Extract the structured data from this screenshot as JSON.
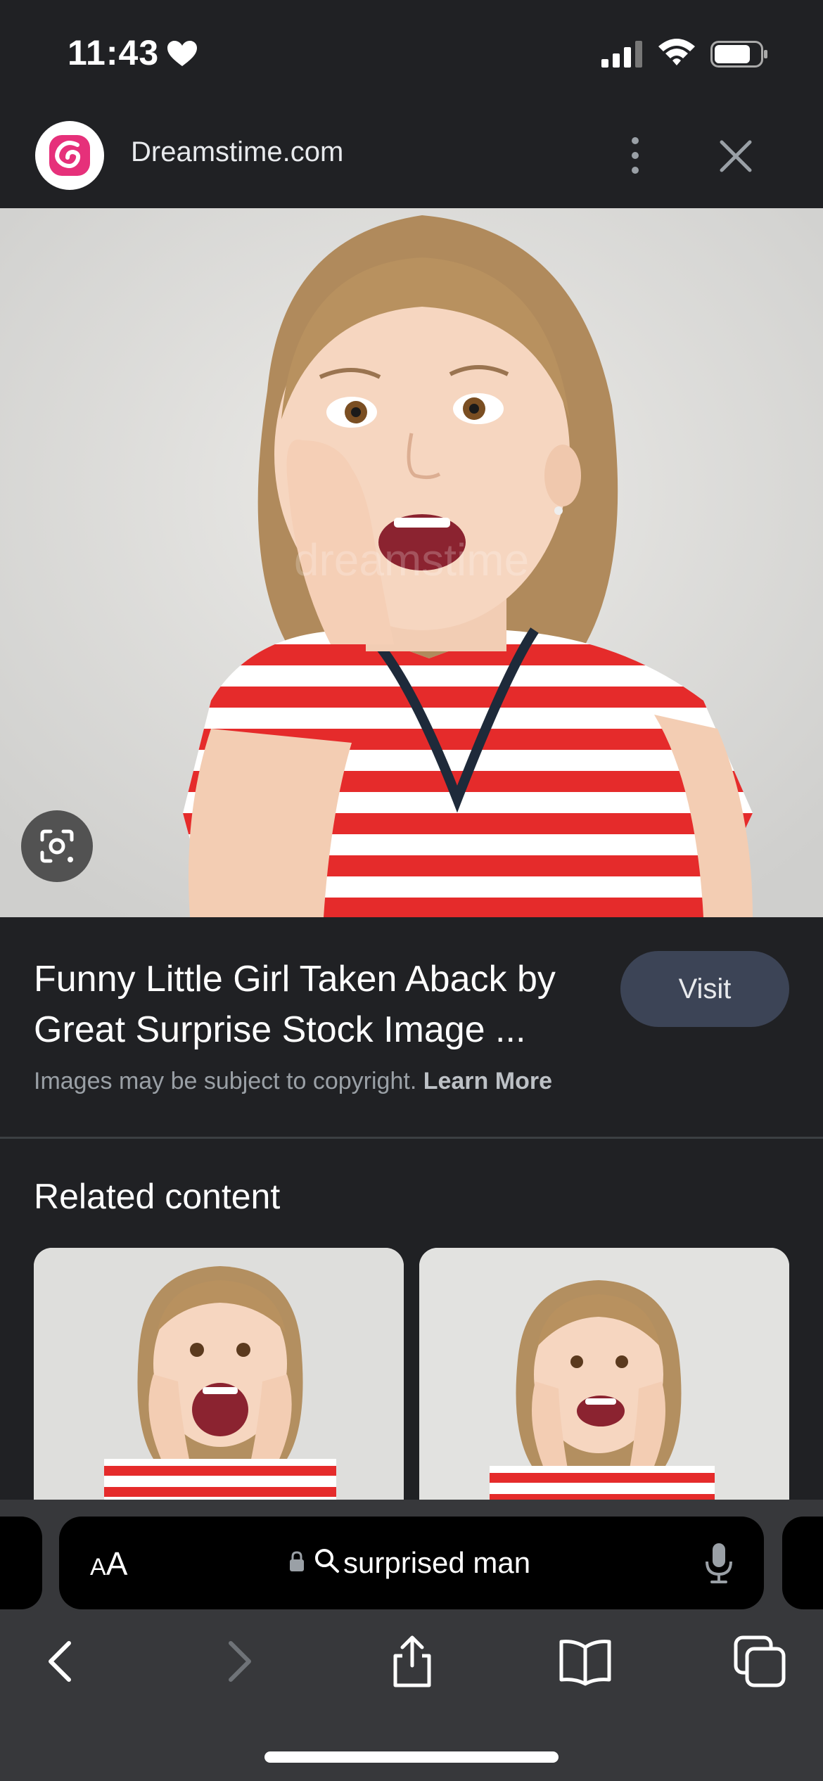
{
  "status_bar": {
    "time": "11:43"
  },
  "header": {
    "site_name": "Dreamstime.com"
  },
  "result": {
    "title": "Funny Little Girl Taken Aback by Great Surprise Stock Image ...",
    "visit_label": "Visit",
    "copyright_text": "Images may be subject to copyright.",
    "learn_more_label": "Learn More"
  },
  "related": {
    "heading": "Related content"
  },
  "address_bar": {
    "text_size_label_small": "A",
    "text_size_label_large": "A",
    "url": "surprised man"
  },
  "colors": {
    "background": "#202124",
    "visit_button": "#3c4456",
    "brand": "#e6307a",
    "toolbar": "#37383b"
  },
  "icons": [
    "heart-icon",
    "signal-icon",
    "wifi-icon",
    "battery-icon",
    "more-vert-icon",
    "close-icon",
    "lens-icon",
    "lock-icon",
    "search-icon",
    "mic-icon",
    "back-icon",
    "forward-icon",
    "share-icon",
    "bookmarks-icon",
    "tabs-icon"
  ]
}
